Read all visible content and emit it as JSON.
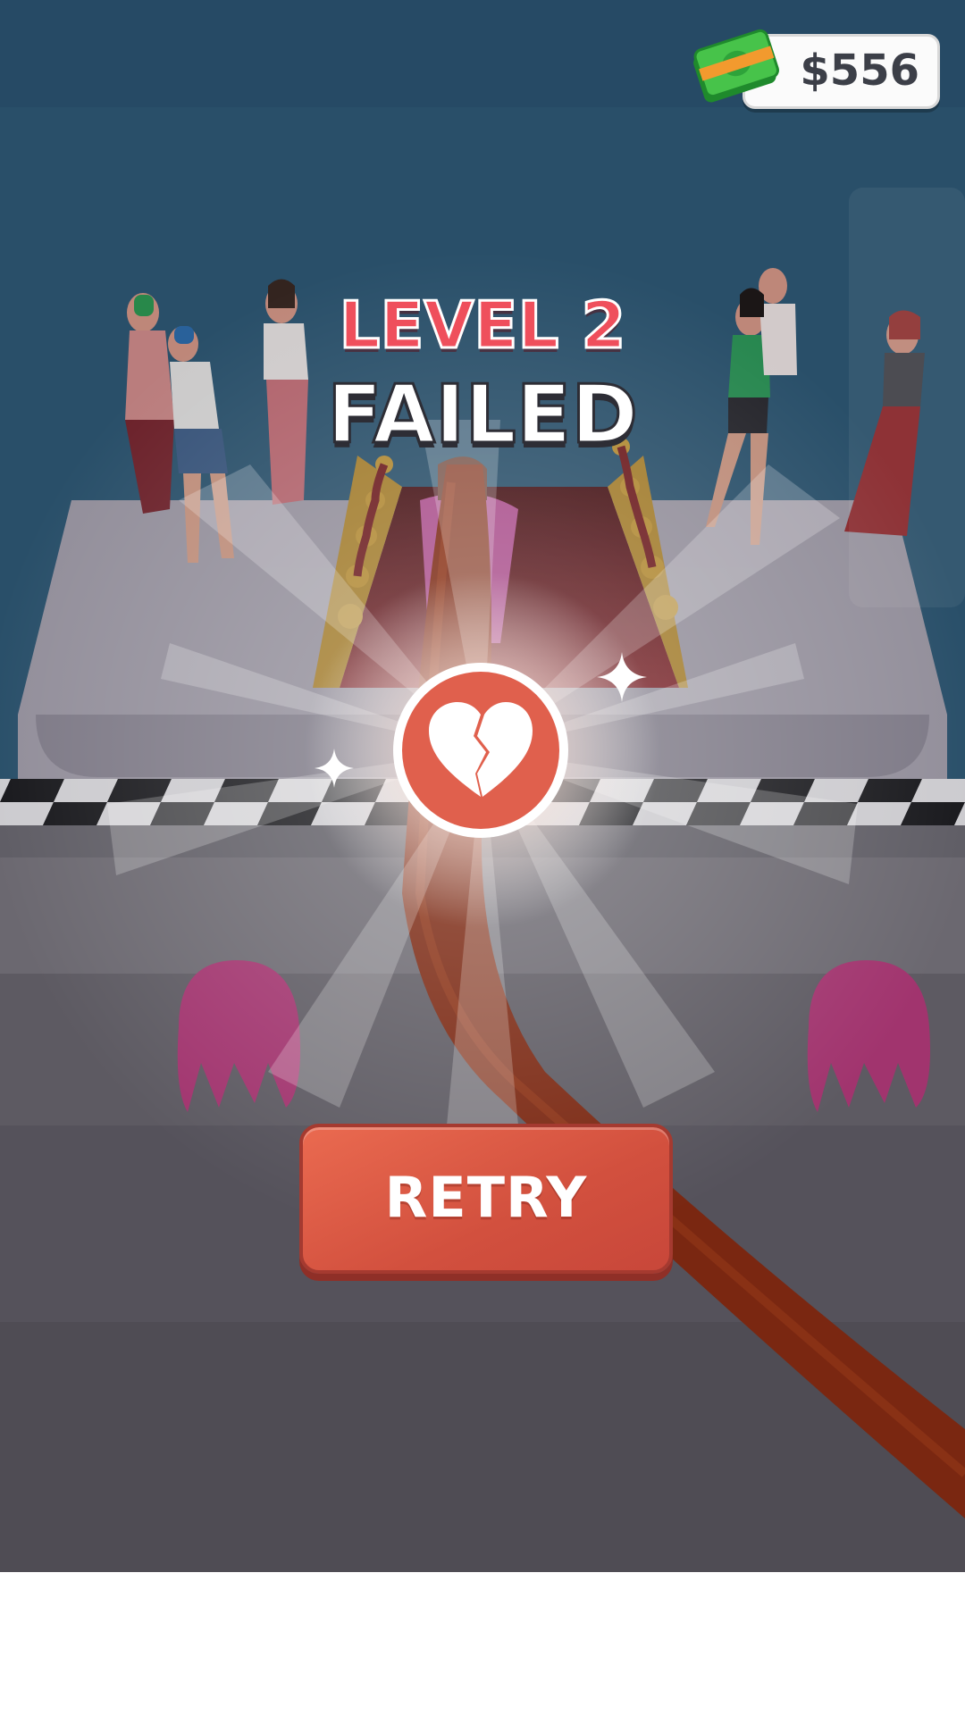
{
  "hud": {
    "money": "$556",
    "money_icon": "cash-stack-icon"
  },
  "result": {
    "level_label": "LEVEL 2",
    "status_label": "FAILED",
    "status_icon": "broken-heart-icon"
  },
  "actions": {
    "retry_label": "RETRY"
  },
  "colors": {
    "accent_red": "#ef4f5c",
    "button": "#d2503e",
    "badge": "#e0604d",
    "sky": "#2f5a78"
  }
}
